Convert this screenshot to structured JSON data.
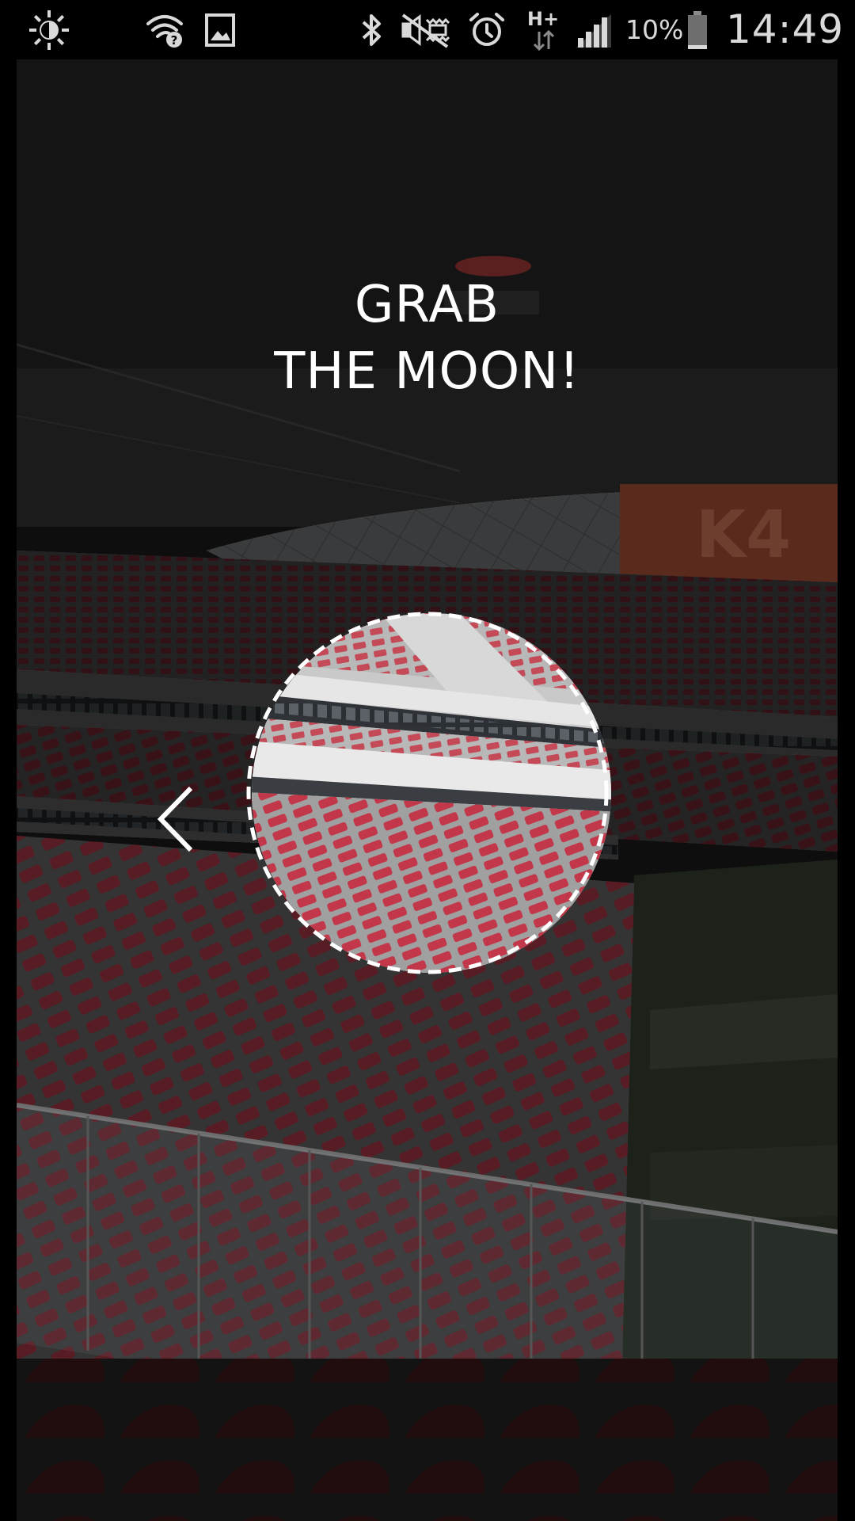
{
  "status_bar": {
    "icons": [
      "brightness-icon",
      "wifi-unknown-icon",
      "image-icon",
      "bluetooth-icon",
      "mute-icon",
      "alarm-icon",
      "hplus-data-icon",
      "signal-icon",
      "battery-icon"
    ],
    "network_type": "H+",
    "battery_percent": "10%",
    "time": "14:49"
  },
  "screen": {
    "headline_line1": "GRAB",
    "headline_line2": "THE MOON!",
    "back_icon": "chevron-left-icon",
    "target_icon": "moon-target-circle",
    "sign_text": "K4"
  },
  "colors": {
    "seat_red": "#8a2a33",
    "dim_overlay": "#000000",
    "text": "#ffffff",
    "status_icon": "#d9d9d9"
  }
}
